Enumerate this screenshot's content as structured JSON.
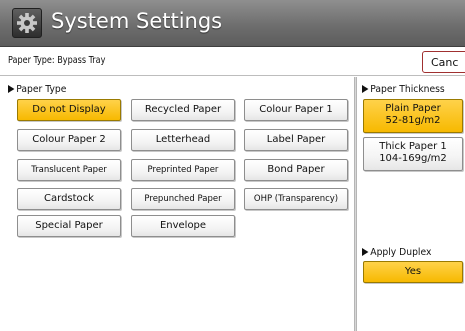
{
  "header": {
    "title": "System Settings",
    "icon": "gear-icon"
  },
  "info_bar": {
    "text": "Paper Type: Bypass Tray",
    "cancel_label": "Canc"
  },
  "paper_type": {
    "heading": "Paper Type",
    "options": [
      "Do not Display",
      "Recycled Paper",
      "Colour Paper 1",
      "Colour Paper 2",
      "Letterhead",
      "Label Paper",
      "Translucent Paper",
      "Preprinted Paper",
      "Bond Paper",
      "Cardstock",
      "Prepunched Paper",
      "OHP (Transparency)",
      "Special Paper",
      "Envelope"
    ],
    "selected": "Do not Display"
  },
  "paper_thickness": {
    "heading": "Paper Thickness",
    "options": [
      {
        "line1": "Plain Paper",
        "line2": "52-81g/m2"
      },
      {
        "line1": "Thick Paper 1",
        "line2": "104-169g/m2"
      }
    ],
    "selected": "Plain Paper"
  },
  "apply_duplex": {
    "heading": "Apply Duplex",
    "value": "Yes"
  },
  "colors": {
    "selected": "#f7b900",
    "titlebar": "#6e6e6e"
  }
}
